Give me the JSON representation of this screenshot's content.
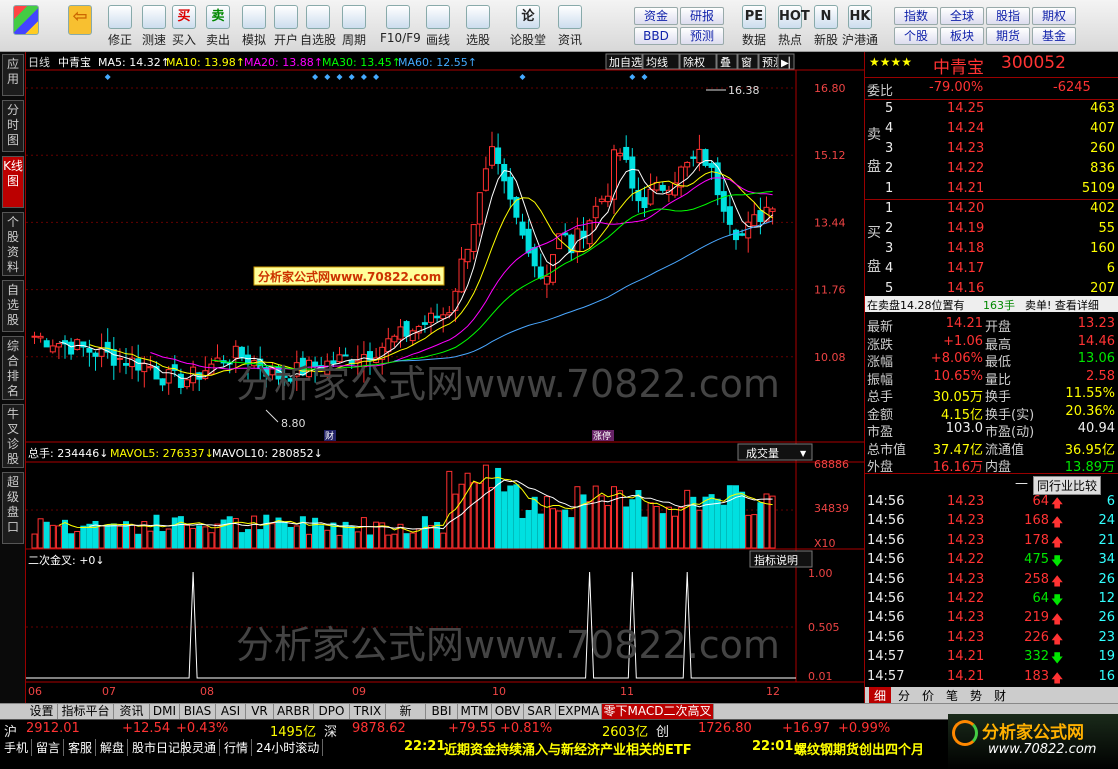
{
  "toolbar": {
    "items": [
      {
        "icon": "grid-icon",
        "label": ""
      },
      {
        "icon": "arrow-left-icon",
        "label": ""
      },
      {
        "icon": "arrow-up-icon",
        "label": "修正"
      },
      {
        "icon": "refresh-icon",
        "label": "测速"
      },
      {
        "icon": "buy-icon",
        "label": "买入",
        "glyph": "买"
      },
      {
        "icon": "sell-icon",
        "label": "卖出",
        "glyph": "卖"
      },
      {
        "icon": "hammer-icon",
        "label": "模拟"
      },
      {
        "icon": "lock-icon",
        "label": "开户"
      },
      {
        "icon": "star-icon",
        "label": "自选股"
      },
      {
        "icon": "clock-icon",
        "label": "周期"
      },
      {
        "icon": "chart-icon",
        "label": "F10/F9"
      },
      {
        "icon": "pen-icon",
        "label": "画线"
      },
      {
        "icon": "select-icon",
        "label": "选股"
      },
      {
        "icon": "forum-icon",
        "label": "论股堂",
        "glyph": "论"
      },
      {
        "icon": "info-icon",
        "label": "资讯"
      }
    ],
    "buttons_a": [
      "资金",
      "研报",
      "BBD",
      "预测"
    ],
    "items2": [
      {
        "icon": "pe-icon",
        "label": "数据",
        "glyph": "PE"
      },
      {
        "icon": "hot-icon",
        "label": "热点",
        "glyph": "HOT"
      },
      {
        "icon": "new-icon",
        "label": "新股",
        "glyph": "N"
      },
      {
        "icon": "hk-icon",
        "label": "沪港通",
        "glyph": "HK"
      }
    ],
    "buttons_b": [
      "指数",
      "全球",
      "股指",
      "期权",
      "个股",
      "板块",
      "期货",
      "基金"
    ]
  },
  "left_tabs": [
    "应用",
    "分时图",
    "K线图",
    "个股资料",
    "自选股",
    "综合排名",
    "牛叉诊股",
    "超级盘口"
  ],
  "chart": {
    "header": {
      "period": "日线",
      "name": "中青宝",
      "ma5": "MA5: 14.32↑",
      "ma10": "MA10: 13.98↑",
      "ma20": "MA20: 13.88↑",
      "ma30": "MA30: 13.45↑",
      "ma60": "MA60: 12.55↑"
    },
    "controls": [
      "加自选",
      "均线",
      "除权",
      "叠",
      "窗",
      "预测"
    ],
    "price_axis": [
      "16.80",
      "15.12",
      "13.44",
      "11.76",
      "10.08"
    ],
    "hi_label": "16.38",
    "lo_label": "8.80",
    "markers": [
      "财",
      "涨停"
    ],
    "watermark_box": "分析家公式网www.70822.com",
    "watermark": "分析家公式网www.70822.com",
    "vol_header": {
      "name": "总手: 234446↓",
      "mavol5": "MAVOL5: 276337↓",
      "mavol10": "MAVOL10: 280852↓"
    },
    "vol_button": "成交量",
    "vol_axis": [
      "68886",
      "34839",
      "X10"
    ],
    "ind_header": "二次金叉: +0↓",
    "ind_button": "指标说明",
    "ind_axis": [
      "1.00",
      "0.505",
      "0.01"
    ],
    "months": [
      "06",
      "07",
      "08",
      "09",
      "10",
      "11",
      "12"
    ],
    "colors": {
      "up": "#ff3030",
      "down": "#00e0e0",
      "ma5": "#ffffff",
      "ma10": "#ffff00",
      "ma20": "#ff00ff",
      "ma30": "#00ff00",
      "ma60": "#4aa7ff"
    }
  },
  "right": {
    "stars": "★★★★",
    "name": "中青宝",
    "code": "300052",
    "weibi_label": "委比",
    "weibi": "-79.00%",
    "weicha": "-6245",
    "sell_label": [
      "卖",
      "盘"
    ],
    "buy_label": [
      "买",
      "盘"
    ],
    "asks": [
      {
        "n": "5",
        "p": "14.25",
        "v": "463"
      },
      {
        "n": "4",
        "p": "14.24",
        "v": "407"
      },
      {
        "n": "3",
        "p": "14.23",
        "v": "260"
      },
      {
        "n": "2",
        "p": "14.22",
        "v": "836"
      },
      {
        "n": "1",
        "p": "14.21",
        "v": "5109"
      }
    ],
    "bids": [
      {
        "n": "1",
        "p": "14.20",
        "v": "402"
      },
      {
        "n": "2",
        "p": "14.19",
        "v": "55"
      },
      {
        "n": "3",
        "p": "14.18",
        "v": "160"
      },
      {
        "n": "4",
        "p": "14.17",
        "v": "6"
      },
      {
        "n": "5",
        "p": "14.16",
        "v": "207"
      }
    ],
    "note": "在卖盘14.28位置有",
    "note_v": "163手",
    "note_btn": "卖单! 查看详细",
    "stats": [
      {
        "l1": "最新",
        "v1": "14.21",
        "c1": "red",
        "l2": "开盘",
        "v2": "13.23",
        "c2": "red"
      },
      {
        "l1": "涨跌",
        "v1": "+1.06",
        "c1": "red",
        "l2": "最高",
        "v2": "14.46",
        "c2": "red"
      },
      {
        "l1": "涨幅",
        "v1": "+8.06%",
        "c1": "red",
        "l2": "最低",
        "v2": "13.06",
        "c2": "grn"
      },
      {
        "l1": "振幅",
        "v1": "10.65%",
        "c1": "red",
        "l2": "量比",
        "v2": "2.58",
        "c2": "red"
      },
      {
        "l1": "总手",
        "v1": "30.05万",
        "c1": "yel",
        "l2": "换手",
        "v2": "11.55%",
        "c2": "yel"
      },
      {
        "l1": "金额",
        "v1": "4.15亿",
        "c1": "yel",
        "l2": "换手(实)",
        "v2": "20.36%",
        "c2": "yel"
      },
      {
        "l1": "市盈",
        "v1": "103.0",
        "c1": "wht",
        "l2": "市盈(动)",
        "v2": "40.94",
        "c2": "wht"
      },
      {
        "l1": "总市值",
        "v1": "37.47亿",
        "c1": "yel",
        "l2": "流通值",
        "v2": "36.95亿",
        "c2": "yel"
      },
      {
        "l1": "外盘",
        "v1": "16.16万",
        "c1": "red",
        "l2": "内盘",
        "v2": "13.89万",
        "c2": "grn"
      }
    ],
    "tick_btn": "同行业比较",
    "ticks": [
      {
        "t": "14:56",
        "p": "14.23",
        "v": "64",
        "d": "up",
        "n": "6"
      },
      {
        "t": "14:56",
        "p": "14.23",
        "v": "168",
        "d": "up",
        "n": "24"
      },
      {
        "t": "14:56",
        "p": "14.23",
        "v": "178",
        "d": "up",
        "n": "21"
      },
      {
        "t": "14:56",
        "p": "14.22",
        "v": "475",
        "d": "down",
        "n": "34"
      },
      {
        "t": "14:56",
        "p": "14.23",
        "v": "258",
        "d": "up",
        "n": "26"
      },
      {
        "t": "14:56",
        "p": "14.22",
        "v": "64",
        "d": "down",
        "n": "12"
      },
      {
        "t": "14:56",
        "p": "14.23",
        "v": "219",
        "d": "up",
        "n": "26"
      },
      {
        "t": "14:56",
        "p": "14.23",
        "v": "226",
        "d": "up",
        "n": "23"
      },
      {
        "t": "14:57",
        "p": "14.21",
        "v": "332",
        "d": "down",
        "n": "19"
      },
      {
        "t": "14:57",
        "p": "14.21",
        "v": "183",
        "d": "up",
        "n": "16"
      },
      {
        "t": "15:00",
        "p": "14.21",
        "v": "3571",
        "d": "up",
        "n": "371"
      }
    ],
    "bottom_tabs": [
      "细",
      "分",
      "价",
      "笔",
      "势",
      "财"
    ]
  },
  "bottom_tabs": [
    "设置",
    "指标平台",
    "资讯",
    "DMI",
    "BIAS",
    "ASI",
    "VR",
    "ARBR",
    "DPO",
    "TRIX",
    "新DMA",
    "BBI",
    "MTM",
    "OBV",
    "SAR",
    "EXPMA",
    "零下MACD二次高叉"
  ],
  "status": {
    "sh_label": "沪",
    "sh_idx": "2912.01",
    "sh_chg": "+12.54",
    "sh_pct": "+0.43%",
    "sh_amt": "1495亿",
    "sz_label": "深",
    "sz_idx": "9878.62",
    "sz_chg": "+79.55",
    "sz_pct": "+0.81%",
    "sz_amt": "2603亿",
    "cy_label": "创",
    "cy_idx": "1726.80",
    "cy_chg": "+16.97",
    "cy_pct": "+0.99%",
    "tabs": [
      "手机",
      "留言",
      "客服",
      "解盘",
      "股市日记",
      "股灵通",
      "行情",
      "24小时滚动"
    ],
    "news1_time": "22:21",
    "news1": "近期资金持续涌入与新经济产业相关的ETF",
    "news2_time": "22:01",
    "news2": "螺纹钢期货创出四个月",
    "logo": "分析家公式网",
    "logo_url": "www.70822.com"
  }
}
